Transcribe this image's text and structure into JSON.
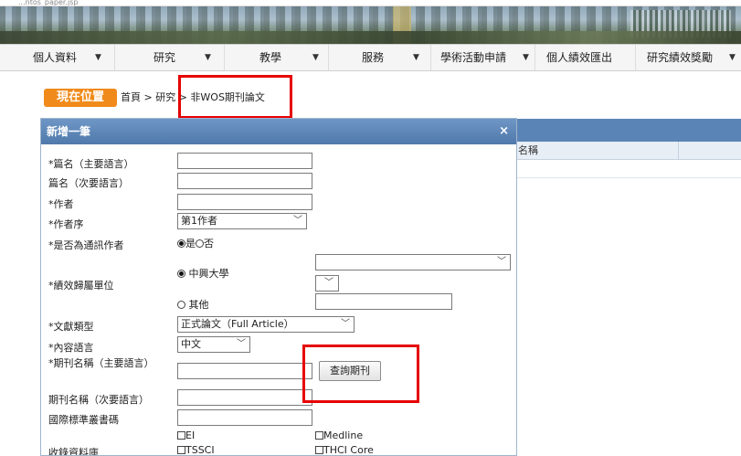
{
  "url_fragment": "...ntos_paper.jsp",
  "nav": {
    "items": [
      {
        "label": "個人資料",
        "has_menu": true
      },
      {
        "label": "研究",
        "has_menu": true
      },
      {
        "label": "教學",
        "has_menu": true
      },
      {
        "label": "服務",
        "has_menu": true
      },
      {
        "label": "學術活動申請",
        "has_menu": true
      },
      {
        "label": "個人績效匯出",
        "has_menu": false
      },
      {
        "label": "研究績效獎勵",
        "has_menu": true
      }
    ],
    "caret": "▼"
  },
  "breadcrumb": {
    "tag": "現在位置",
    "path": "首頁 > 研究 > 非WOS期刊論文"
  },
  "background_table": {
    "column_header": "名稱"
  },
  "dialog": {
    "title": "新增一筆",
    "close": "×",
    "fields": {
      "title_primary": {
        "label": "*篇名（主要語言）",
        "value": ""
      },
      "title_secondary": {
        "label": "篇名（次要語言）",
        "value": ""
      },
      "author": {
        "label": "*作者",
        "value": ""
      },
      "author_order": {
        "label": "*作者序",
        "selected": "第1作者"
      },
      "corresponding": {
        "label": "*是否為通訊作者",
        "yes": "是",
        "no": "否",
        "selected": "yes"
      },
      "affiliation": {
        "label": "*績效歸屬單位",
        "option_nchu": "中興大學",
        "option_other": "其他",
        "selected": "nchu",
        "other_value": ""
      },
      "doc_type": {
        "label": "*文獻類型",
        "selected": "正式論文（Full Article）"
      },
      "content_language": {
        "label": "*內容語言",
        "selected": "中文"
      },
      "journal_primary": {
        "label": "*期刊名稱（主要語言）",
        "value": "",
        "button": "查詢期刊"
      },
      "journal_secondary": {
        "label": "期刊名稱（次要語言）",
        "value": ""
      },
      "issn": {
        "label": "國際標準叢書碼",
        "value": ""
      },
      "databases": {
        "label": "收錄資料庫",
        "options": [
          "EI",
          "Medline",
          "TSSCI",
          "THCI Core"
        ]
      }
    }
  },
  "colors": {
    "dialog_header": "#5a84b6",
    "crumb_tag": "#f08a1a",
    "highlight": "#e60000"
  }
}
